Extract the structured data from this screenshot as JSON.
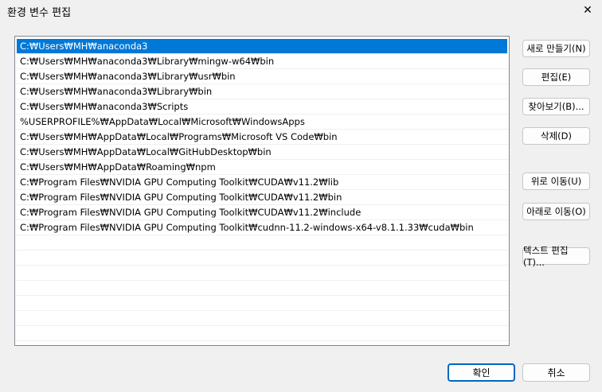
{
  "window": {
    "title": "환경 변수 편집",
    "close_glyph": "✕"
  },
  "paths": [
    "C:₩Users₩MH₩anaconda3",
    "C:₩Users₩MH₩anaconda3₩Library₩mingw-w64₩bin",
    "C:₩Users₩MH₩anaconda3₩Library₩usr₩bin",
    "C:₩Users₩MH₩anaconda3₩Library₩bin",
    "C:₩Users₩MH₩anaconda3₩Scripts",
    "%USERPROFILE%₩AppData₩Local₩Microsoft₩WindowsApps",
    "C:₩Users₩MH₩AppData₩Local₩Programs₩Microsoft VS Code₩bin",
    "C:₩Users₩MH₩AppData₩Local₩GitHubDesktop₩bin",
    "C:₩Users₩MH₩AppData₩Roaming₩npm",
    "C:₩Program Files₩NVIDIA GPU Computing Toolkit₩CUDA₩v11.2₩lib",
    "C:₩Program Files₩NVIDIA GPU Computing Toolkit₩CUDA₩v11.2₩bin",
    "C:₩Program Files₩NVIDIA GPU Computing Toolkit₩CUDA₩v11.2₩include",
    "C:₩Program Files₩NVIDIA GPU Computing Toolkit₩cudnn-11.2-windows-x64-v8.1.1.33₩cuda₩bin"
  ],
  "selected_index": 0,
  "buttons": {
    "new": "새로 만들기(N)",
    "edit": "편집(E)",
    "browse": "찾아보기(B)...",
    "delete": "삭제(D)",
    "move_up": "위로 이동(U)",
    "move_down": "아래로 이동(O)",
    "edit_text": "텍스트 편집(T)..."
  },
  "dialog": {
    "ok": "확인",
    "cancel": "취소"
  },
  "colors": {
    "selection": "#0078d7",
    "primary_border": "#0067c0"
  }
}
